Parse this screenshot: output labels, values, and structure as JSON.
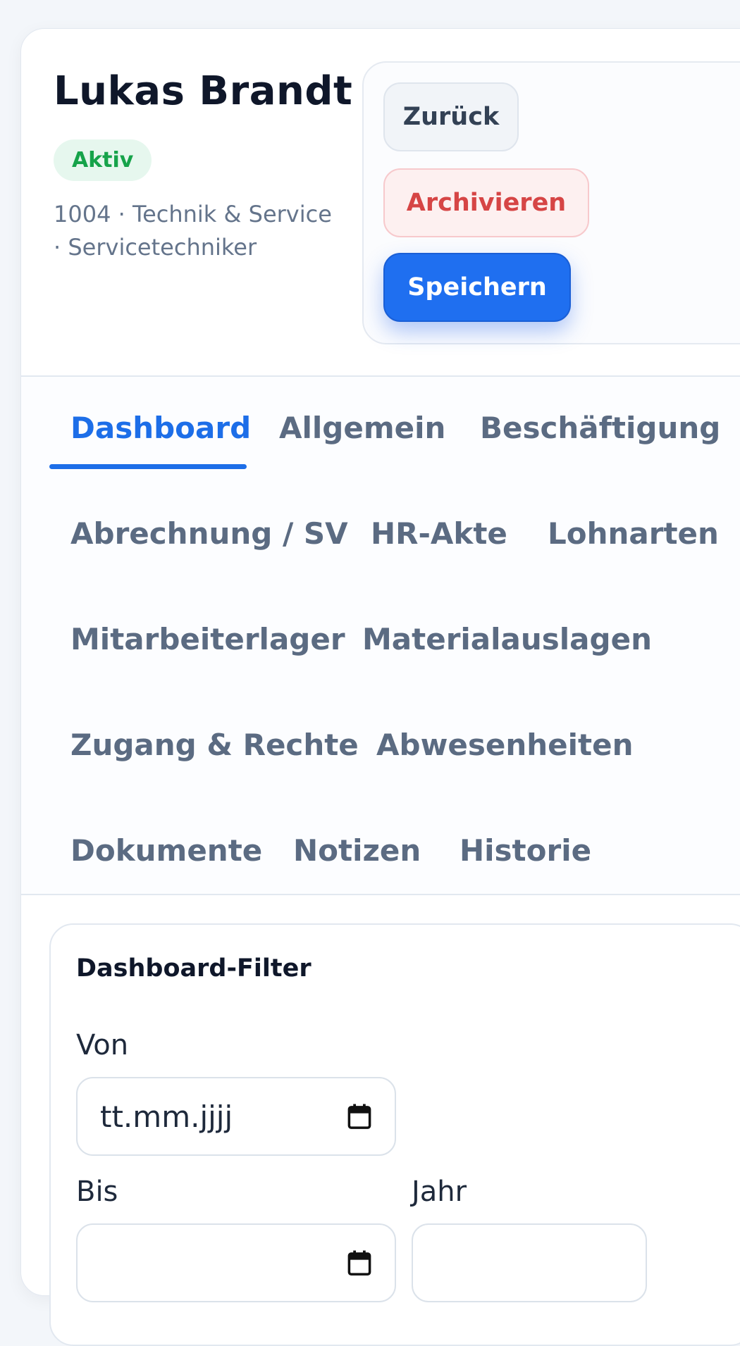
{
  "employee": {
    "name": "Lukas Brandt",
    "status": "Aktiv",
    "meta_line1": "1004 · Technik & Service",
    "meta_line2": "· Servicetechniker"
  },
  "actions": {
    "back": "Zurück",
    "archive": "Archivieren",
    "save": "Speichern"
  },
  "tabs": [
    {
      "label": "Dashboard",
      "active": true
    },
    {
      "label": "Allgemein"
    },
    {
      "label": "Beschäftigung"
    },
    {
      "label": "Abrechnung / SV"
    },
    {
      "label": "HR-Akte"
    },
    {
      "label": "Lohnarten"
    },
    {
      "label": "Mitarbeiterlager"
    },
    {
      "label": "Materialauslagen"
    },
    {
      "label": "Zugang & Rechte"
    },
    {
      "label": "Abwesenheiten"
    },
    {
      "label": "Dokumente"
    },
    {
      "label": "Notizen"
    },
    {
      "label": "Historie"
    }
  ],
  "filter": {
    "title": "Dashboard-Filter",
    "from_label": "Von",
    "from_placeholder": "tt.mm.jjjj",
    "to_label": "Bis",
    "year_label": "Jahr"
  },
  "colors": {
    "accent": "#1d6ee8",
    "success": "#16a34a",
    "danger": "#d64545"
  }
}
